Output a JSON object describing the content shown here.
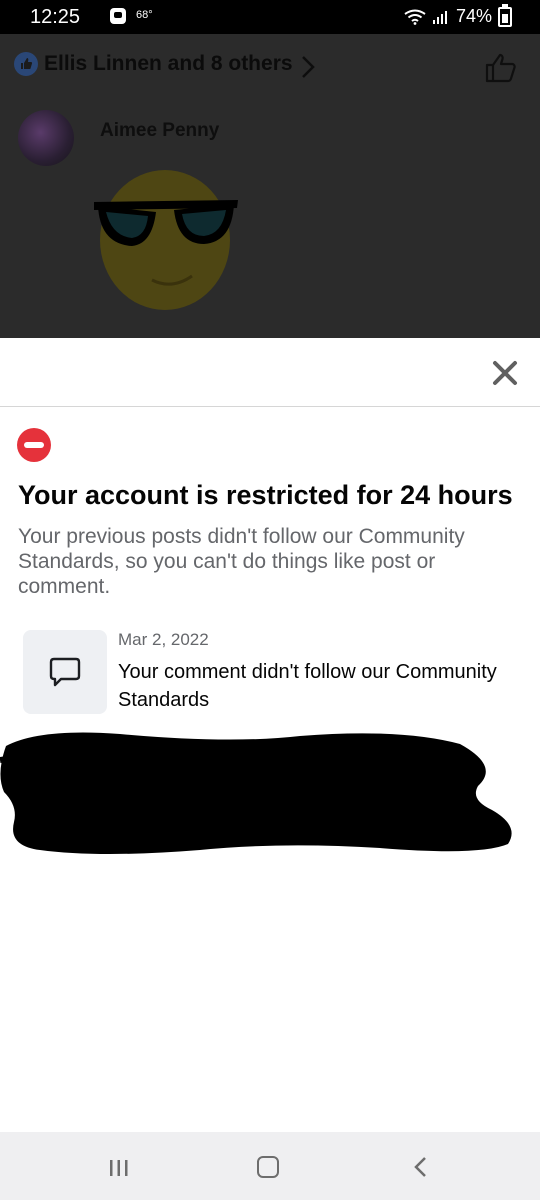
{
  "status_bar": {
    "time": "12:25",
    "temperature": "68°",
    "battery": "74%"
  },
  "background": {
    "reactions_text": "Ellis Linnen and 8 others",
    "commenter_name": "Aimee Penny"
  },
  "sheet": {
    "title": "Your account is restricted for 24 hours",
    "description": "Your previous posts didn't follow our Community Standards, so you can't do things like post or comment.",
    "violation": {
      "date": "Mar 2, 2022",
      "text": "Your comment didn't follow our Community Standards"
    }
  },
  "colors": {
    "restrict_red": "#e5323b",
    "brand_blue": "#1877f2"
  },
  "icons": [
    "like-icon",
    "chevron-right-icon",
    "close-icon",
    "restriction-icon",
    "comment-bubble-icon",
    "recent-apps-icon",
    "home-icon",
    "back-icon"
  ]
}
